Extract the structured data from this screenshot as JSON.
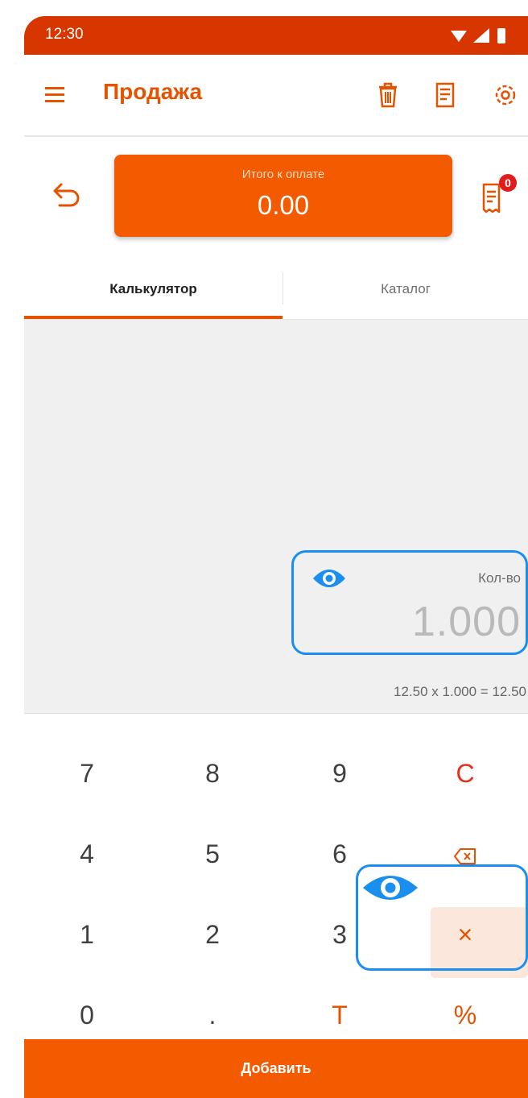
{
  "status_bar": {
    "time": "12:30"
  },
  "app_bar": {
    "title": "Продажа"
  },
  "total": {
    "label": "Итого к оплате",
    "value": "0.00"
  },
  "receipt": {
    "badge_count": "0"
  },
  "tabs": [
    {
      "label": "Калькулятор"
    },
    {
      "label": "Каталог"
    }
  ],
  "quantity": {
    "label": "Кол-во",
    "value": "1.000",
    "formula": "12.50 x 1.000 = 12.50"
  },
  "keypad": {
    "k7": "7",
    "k8": "8",
    "k9": "9",
    "clear": "C",
    "k4": "4",
    "k5": "5",
    "k6": "6",
    "k1": "1",
    "k2": "2",
    "k3": "3",
    "multiply": "×",
    "k0": "0",
    "dot": ".",
    "tare": "T",
    "percent": "%"
  },
  "add_button": {
    "label": "Добавить"
  },
  "colors": {
    "accent": "#f45a00",
    "status_bar": "#d83600",
    "highlight": "#1a8ff0",
    "clear": "#e0331e"
  }
}
